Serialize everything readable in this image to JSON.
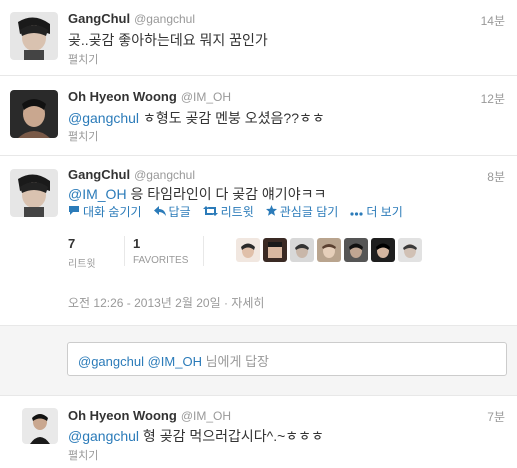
{
  "tweets": [
    {
      "name": "GangChul",
      "handle": "@gangchul",
      "time": "14분",
      "text": "곶..곶감 좋아하는데요 뭐지 꿈인가",
      "expand": "펼치기"
    },
    {
      "name": "Oh Hyeon Woong",
      "handle": "@IM_OH",
      "time": "12분",
      "mention": "@gangchul",
      "text": " ㅎ형도 곶감 멘붕 오셨음??ㅎㅎ",
      "expand": "펼치기"
    }
  ],
  "expanded": {
    "name": "GangChul",
    "handle": "@gangchul",
    "time": "8분",
    "mention": "@IM_OH",
    "text": " 응 타임라인이 다 곶감 얘기야ㅋㅋ",
    "actions": {
      "conversation": "대화 숨기기",
      "reply": "답글",
      "retweet": "리트윗",
      "favorite": "관심글 담기",
      "more": "더 보기"
    },
    "stats": {
      "retweets_count": "7",
      "retweets_label": "리트윗",
      "favorites_count": "1",
      "favorites_label": "FAVORITES"
    },
    "date": "오전 12:26 - 2013년 2월 20일",
    "separator": " · ",
    "detail": "자세히"
  },
  "reply": {
    "mention1": "@gangchul",
    "mention2": "@IM_OH",
    "suffix": "님에게 답장"
  },
  "last_tweet": {
    "name": "Oh Hyeon Woong",
    "handle": "@IM_OH",
    "time": "7분",
    "mention": "@gangchul",
    "text": " 형 곶감 먹으러갑시다^.~ㅎㅎㅎ",
    "expand": "펼치기"
  },
  "colors": {
    "link": "#2b7bb9",
    "muted": "#999999",
    "text": "#333333"
  }
}
